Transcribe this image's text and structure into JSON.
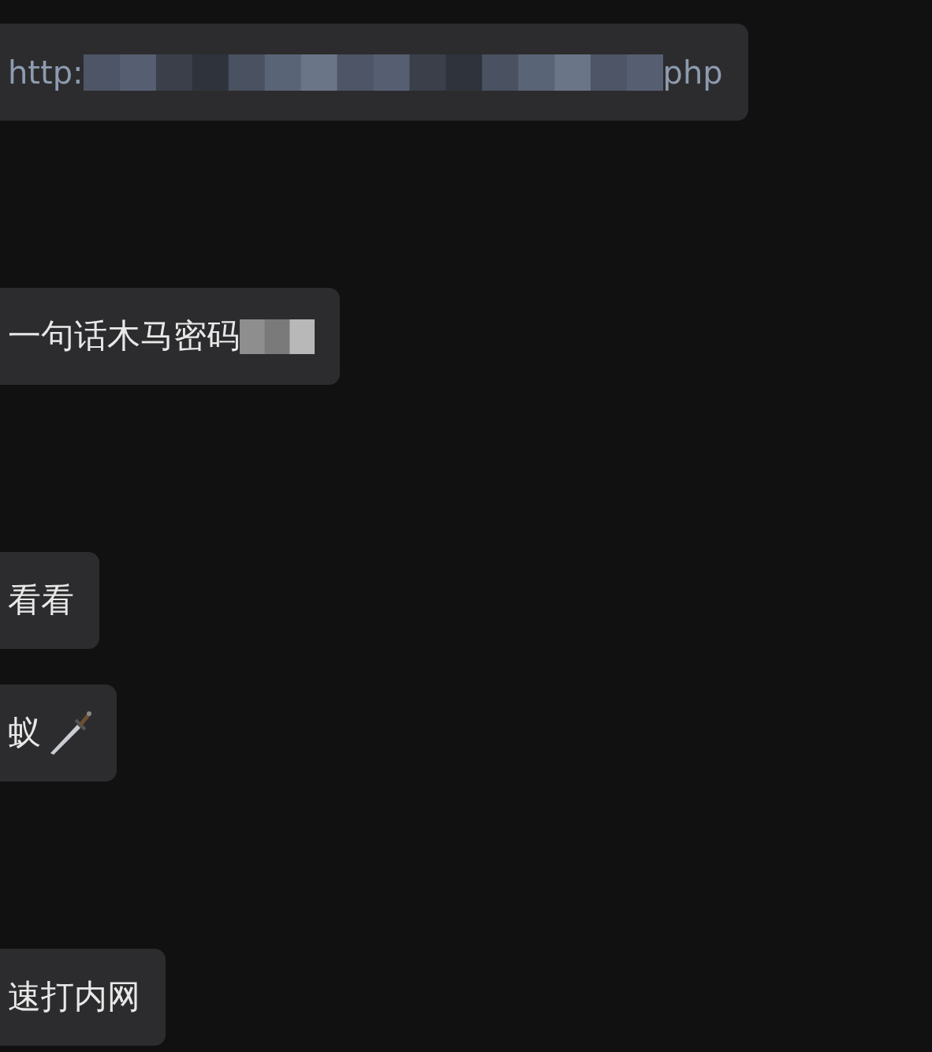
{
  "messages": [
    {
      "kind": "link",
      "segments": [
        {
          "kind": "text",
          "text": "http:"
        },
        {
          "kind": "redaction"
        },
        {
          "kind": "text",
          "text": "php"
        }
      ]
    },
    {
      "kind": "text",
      "segments": [
        {
          "kind": "text",
          "text": "一句话木马密码"
        },
        {
          "kind": "redaction"
        }
      ]
    },
    {
      "kind": "text",
      "segments": [
        {
          "kind": "text",
          "text": "看看"
        }
      ]
    },
    {
      "kind": "text",
      "segments": [
        {
          "kind": "text",
          "text": "蚁"
        },
        {
          "kind": "dagger"
        }
      ]
    },
    {
      "kind": "text",
      "segments": [
        {
          "kind": "text",
          "text": "速打内网"
        }
      ]
    }
  ]
}
